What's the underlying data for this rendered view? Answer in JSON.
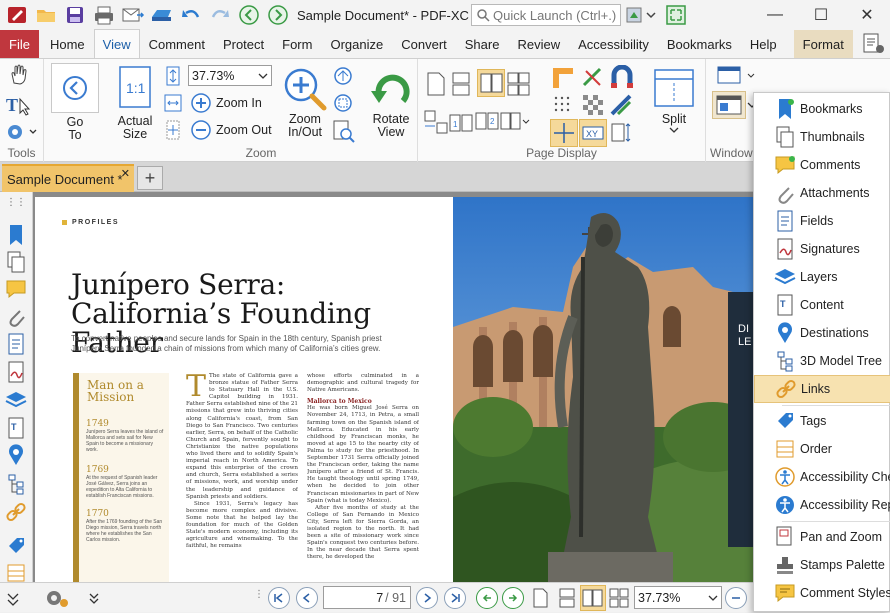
{
  "app": {
    "title": "Sample Document* - PDF-XCh...",
    "quick_launch_placeholder": "Quick Launch (Ctrl+.)"
  },
  "menu_tabs": [
    "File",
    "Home",
    "View",
    "Comment",
    "Protect",
    "Form",
    "Organize",
    "Convert",
    "Share",
    "Review",
    "Accessibility",
    "Bookmarks",
    "Help",
    "Format"
  ],
  "active_tab": "View",
  "ribbon": {
    "groups": {
      "tools": "Tools",
      "zoom": "Zoom",
      "page_display": "Page Display",
      "window": "Window"
    },
    "go_to": "Go",
    "go_to_2": "To",
    "actual_size": "Actual",
    "actual_size_2": "Size",
    "zoom_value": "37.73%",
    "zoom_in": "Zoom In",
    "zoom_out": "Zoom Out",
    "zoom_inout": "Zoom",
    "zoom_inout_2": "In/Out",
    "rotate_view": "Rotate",
    "rotate_view_2": "View",
    "split": "Split"
  },
  "document_tab": "Sample Document *",
  "page_content": {
    "section": "PROFILES",
    "title_line1": "Junípero Serra:",
    "title_line2": "California’s Founding Father",
    "subtitle": "To convert native peoples and secure lands for Spain in the 18th century, Spanish priest Junípero Serra founded a chain of missions from which many of California’s cities grew.",
    "sidebar_title": "Man on a Mission",
    "timeline": [
      {
        "year": "1749",
        "text": "Junípero Serra leaves the island of Mallorca and sets sail for New Spain to become a missionary work."
      },
      {
        "year": "1769",
        "text": "At the request of Spanish leader José Gálvez, Serra joins an expedition to Alta California to establish Franciscan missions."
      },
      {
        "year": "1770",
        "text": "After the 1769 founding of the San Diego mission, Serra travels north where he establishes the San Carlos mission."
      }
    ],
    "col1": "The state of California gave a bronze statue of Father Serra to Statuary Hall in the U.S. Capitol building in 1931. Father Serra established nine of the 21 missions that grew into thriving cities along California's coast, from San Diego to San Francisco. Two centuries earlier, Serra, on behalf of the Catholic Church and Spain, fervently sought to Christianize the native populations who lived there and to solidify Spain's imperial reach in North America. To expand this enterprise of the crown and church, Serra established a series of missions, work, and worship under the leadership and guidance of Spanish priests and soldiers.",
    "col1b": "Since 1931, Serra's legacy has become more complex and divisive. Some note that he helped lay the foundation for much of the Golden State's modern economy, including its agriculture and winemaking. To the faithful, he remains",
    "col2a": "whose efforts culminated in a demographic and cultural tragedy for Native Americans.",
    "col2_heading": "Mallorca to Mexico",
    "col2b": "He was born Miguel José Serra on November 24, 1713, in Petra, a small farming town on the Spanish island of Mallorca. Educated in his early childhood by Franciscan monks, he moved at age 15 to the nearby city of Palma to study for the priesthood. In September 1731 Serra officially joined the Franciscan order, taking the name Junípero after a friend of St. Francis. He taught theology until spring 1749, when he decided to join other Franciscan missionaries in part of New Spain (what is today Mexico).",
    "col2c": "After five months of study at the College of San Fernando in Mexico City, Serra left for Sierra Gorda, an isolated region to the north. It had been a site of missionary work since Spain's conquest two centuries before. In the near decade that Serra spent there, he developed the"
  },
  "status": {
    "page_current": "7",
    "page_total": "/ 91",
    "zoom": "37.73%"
  },
  "panels_menu": [
    {
      "label": "Bookmarks",
      "icon": "bookmark-icon"
    },
    {
      "label": "Thumbnails",
      "icon": "thumbnails-icon"
    },
    {
      "label": "Comments",
      "icon": "comments-icon"
    },
    {
      "label": "Attachments",
      "icon": "paperclip-icon"
    },
    {
      "label": "Fields",
      "icon": "fields-icon"
    },
    {
      "label": "Signatures",
      "icon": "signature-icon"
    },
    {
      "label": "Layers",
      "icon": "layers-icon"
    },
    {
      "label": "Content",
      "icon": "content-icon"
    },
    {
      "label": "Destinations",
      "icon": "destination-pin-icon"
    },
    {
      "label": "3D Model Tree",
      "icon": "model-tree-icon"
    },
    {
      "label": "Links",
      "icon": "link-icon"
    },
    {
      "label": "Tags",
      "icon": "tag-icon"
    },
    {
      "label": "Order",
      "icon": "order-icon"
    },
    {
      "label": "Accessibility Chec",
      "icon": "accessibility-check-icon"
    },
    {
      "label": "Accessibility Repo",
      "icon": "accessibility-report-icon"
    },
    {
      "label": "Pan and Zoom",
      "icon": "pan-zoom-icon"
    },
    {
      "label": "Stamps Palette",
      "icon": "stamp-icon"
    },
    {
      "label": "Comment Styles",
      "icon": "comment-styles-icon"
    }
  ],
  "colors": {
    "file_tab": "#c0373e",
    "accent": "#1c5fa8",
    "doc_tab": "#f1c46a",
    "highlight": "#f7e2b0",
    "magazine_gold": "#b08a2c"
  }
}
